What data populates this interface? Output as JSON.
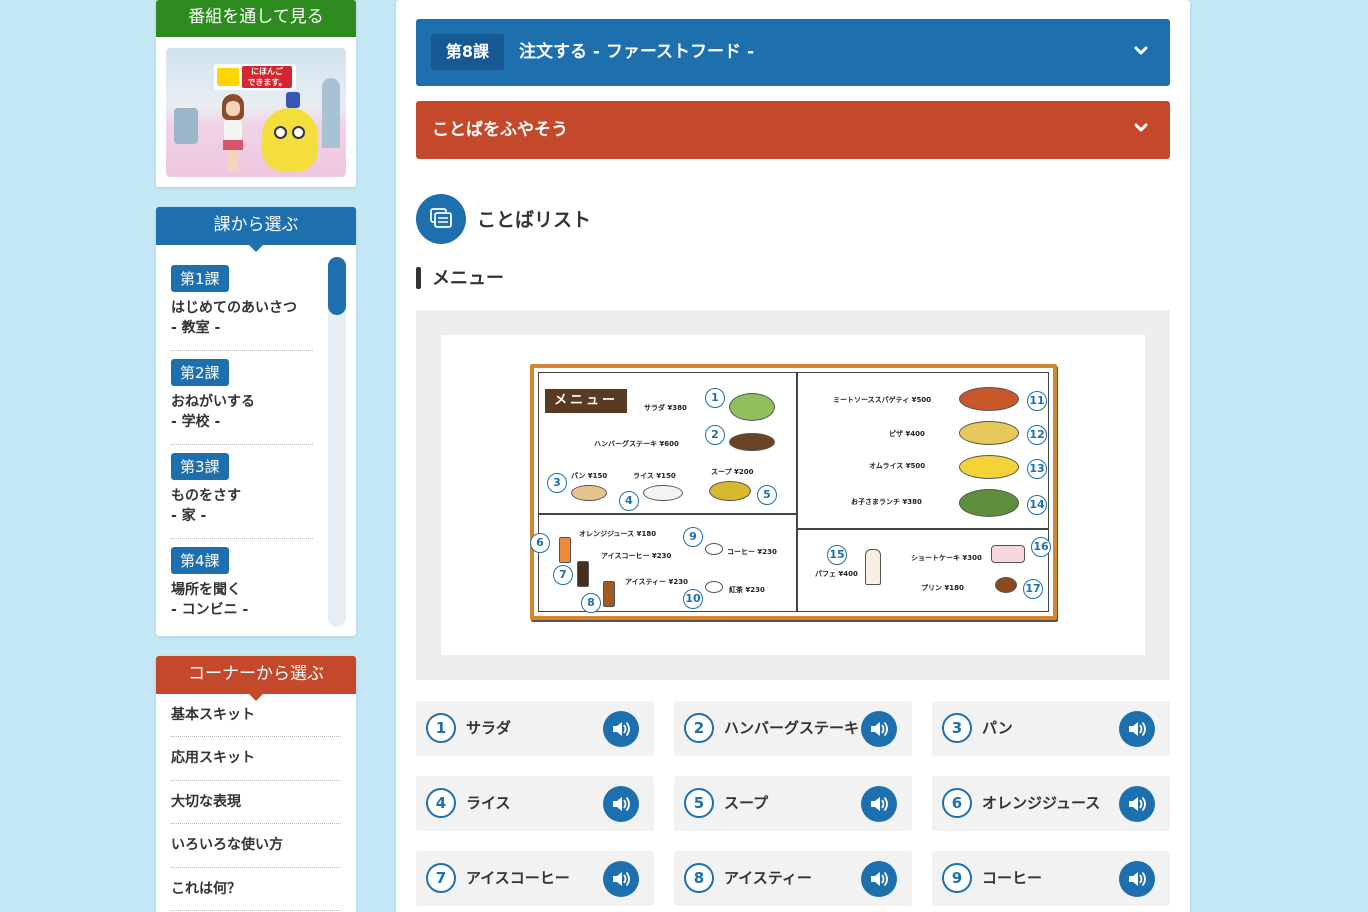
{
  "sidebar": {
    "program": {
      "heading": "番組を通して見る",
      "logo_line1": "にほんご",
      "logo_line2": "できます。"
    },
    "lessons": {
      "heading": "課から選ぶ",
      "items": [
        {
          "tag": "第1課",
          "title": "はじめてのあいさつ",
          "sub": "- 教室 -"
        },
        {
          "tag": "第2課",
          "title": "おねがいする",
          "sub": "- 学校 -"
        },
        {
          "tag": "第3課",
          "title": "ものをさす",
          "sub": "- 家 -"
        },
        {
          "tag": "第4課",
          "title": "場所を聞く",
          "sub": "- コンビニ -"
        }
      ]
    },
    "corners": {
      "heading": "コーナーから選ぶ",
      "items": [
        "基本スキット",
        "応用スキット",
        "大切な表現",
        "いろいろな使い方",
        "これは何？"
      ]
    }
  },
  "main": {
    "lesson_bar": {
      "badge": "第8課",
      "title": "注文する - ファーストフード -"
    },
    "words_bar": {
      "title": "ことばをふやそう"
    },
    "section_title": "ことばリスト",
    "subsection_title": "メニュー",
    "menu_board": {
      "label": "メニュー",
      "items": [
        {
          "num": "1",
          "text": "サラダ ¥380"
        },
        {
          "num": "2",
          "text": "ハンバーグステーキ ¥600"
        },
        {
          "num": "3",
          "text": "パン ¥150"
        },
        {
          "num": "4",
          "text": "ライス ¥150"
        },
        {
          "num": "5",
          "text": "スープ ¥200"
        },
        {
          "num": "6",
          "text": "オレンジジュース ¥180"
        },
        {
          "num": "7",
          "text": "アイスコーヒー ¥230"
        },
        {
          "num": "8",
          "text": "アイスティー ¥230"
        },
        {
          "num": "9",
          "text": "コーヒー ¥230"
        },
        {
          "num": "10",
          "text": "紅茶 ¥230"
        },
        {
          "num": "11",
          "text": "ミートソーススパゲティ ¥500"
        },
        {
          "num": "12",
          "text": "ピザ ¥400"
        },
        {
          "num": "13",
          "text": "オムライス ¥500"
        },
        {
          "num": "14",
          "text": "お子さまランチ ¥380"
        },
        {
          "num": "15",
          "text": "パフェ ¥400"
        },
        {
          "num": "16",
          "text": "ショートケーキ ¥300"
        },
        {
          "num": "17",
          "text": "プリン ¥180"
        }
      ]
    },
    "word_cards": [
      {
        "num": "1",
        "word": "サラダ"
      },
      {
        "num": "2",
        "word": "ハンバーグステーキ"
      },
      {
        "num": "3",
        "word": "パン"
      },
      {
        "num": "4",
        "word": "ライス"
      },
      {
        "num": "5",
        "word": "スープ"
      },
      {
        "num": "6",
        "word": "オレンジジュース"
      },
      {
        "num": "7",
        "word": "アイスコーヒー"
      },
      {
        "num": "8",
        "word": "アイスティー"
      },
      {
        "num": "9",
        "word": "コーヒー"
      }
    ]
  }
}
